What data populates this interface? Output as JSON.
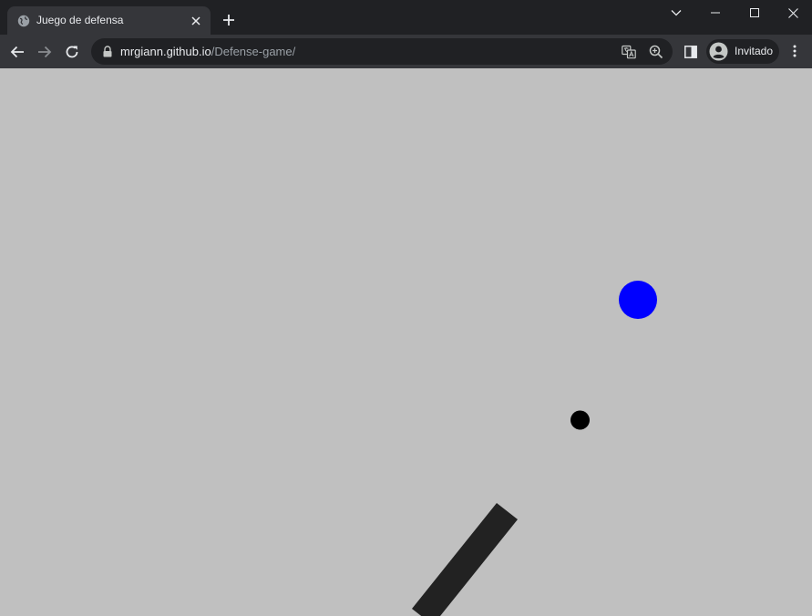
{
  "browser": {
    "tab": {
      "title": "Juego de defensa",
      "favicon_icon": "globe-icon",
      "close_icon": "close-icon"
    },
    "new_tab_icon": "plus-icon",
    "window_controls": [
      "chevron-down-icon",
      "minimize-icon",
      "maximize-icon",
      "close-icon"
    ],
    "nav": {
      "back_icon": "arrow-left-icon",
      "forward_icon": "arrow-right-icon",
      "reload_icon": "reload-icon"
    },
    "address": {
      "lock_icon": "lock-icon",
      "host": "mrgiann.github.io",
      "path": "/Defense-game/",
      "translate_icon": "translate-icon",
      "zoom_icon": "zoom-in-icon"
    },
    "side_panel_icon": "side-panel-icon",
    "profile": {
      "avatar_icon": "account-icon",
      "label": "Invitado"
    },
    "menu_icon": "kebab-menu-icon"
  },
  "game": {
    "background_color": "#c0c0c0",
    "enemy": {
      "color": "#0000ff",
      "shape": "circle"
    },
    "projectile": {
      "color": "#000000",
      "shape": "circle"
    },
    "cannon": {
      "color": "#222222",
      "shape": "barrel"
    }
  }
}
